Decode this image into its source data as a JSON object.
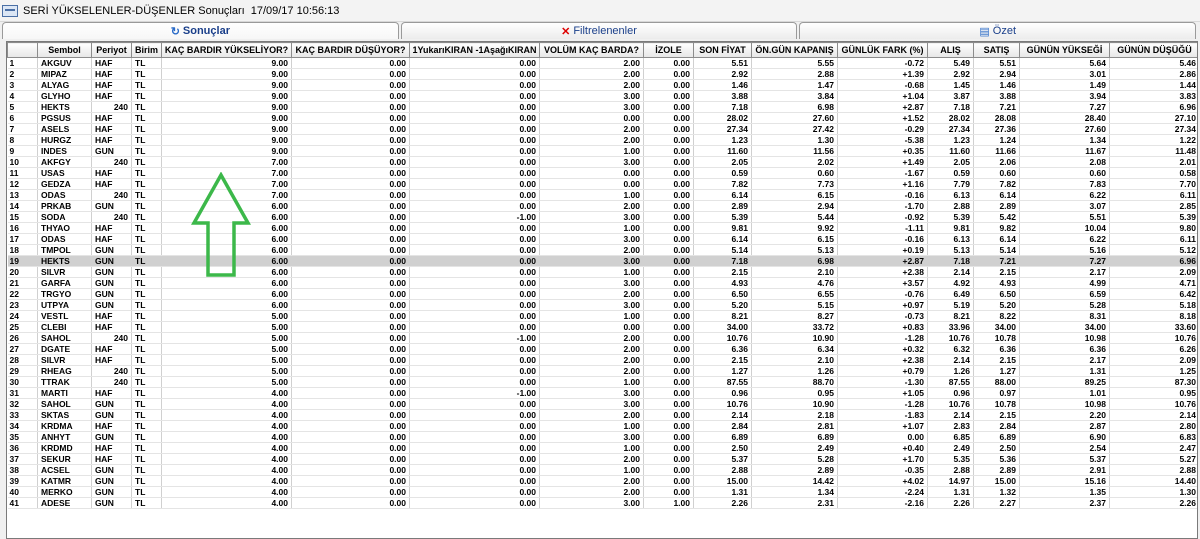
{
  "window": {
    "title": "SERİ YÜKSELENLER-DÜŞENLER Sonuçları",
    "timestamp": "17/09/17 10:56:13"
  },
  "tabs": [
    {
      "label": "Sonuçlar",
      "icon": "refresh-icon"
    },
    {
      "label": "Filtrelenenler",
      "icon": "red-x-icon"
    },
    {
      "label": "Özet",
      "icon": "summary-icon"
    }
  ],
  "table": {
    "headers": [
      "",
      "Sembol",
      "Periyot",
      "Birim",
      "KAÇ BARDIR YÜKSELİYOR?",
      "KAÇ BARDIR DÜŞÜYOR?",
      "1YukarıKIRAN -1AşağıKIRAN",
      "VOLÜM KAÇ BARDA?",
      "İZOLE",
      "SON FİYAT",
      "ÖN.GÜN KAPANIŞ",
      "GÜNLÜK FARK (%)",
      "ALIŞ",
      "SATIŞ",
      "GÜNÜN YÜKSEĞİ",
      "GÜNÜN DÜŞÜĞÜ"
    ],
    "selected_row": 19,
    "rows": [
      [
        "1",
        "AKGUV",
        "HAF",
        "TL",
        "9.00",
        "0.00",
        "0.00",
        "2.00",
        "0.00",
        "5.51",
        "5.55",
        "-0.72",
        "5.49",
        "5.51",
        "5.64",
        "5.46"
      ],
      [
        "2",
        "MIPAZ",
        "HAF",
        "TL",
        "9.00",
        "0.00",
        "0.00",
        "2.00",
        "0.00",
        "2.92",
        "2.88",
        "+1.39",
        "2.92",
        "2.94",
        "3.01",
        "2.86"
      ],
      [
        "3",
        "ALYAG",
        "HAF",
        "TL",
        "9.00",
        "0.00",
        "0.00",
        "2.00",
        "0.00",
        "1.46",
        "1.47",
        "-0.68",
        "1.45",
        "1.46",
        "1.49",
        "1.44"
      ],
      [
        "4",
        "GLYHO",
        "HAF",
        "TL",
        "9.00",
        "0.00",
        "0.00",
        "3.00",
        "0.00",
        "3.88",
        "3.84",
        "+1.04",
        "3.87",
        "3.88",
        "3.94",
        "3.83"
      ],
      [
        "5",
        "HEKTS",
        "240",
        "TL",
        "9.00",
        "0.00",
        "0.00",
        "3.00",
        "0.00",
        "7.18",
        "6.98",
        "+2.87",
        "7.18",
        "7.21",
        "7.27",
        "6.96"
      ],
      [
        "6",
        "PGSUS",
        "HAF",
        "TL",
        "9.00",
        "0.00",
        "0.00",
        "0.00",
        "0.00",
        "28.02",
        "27.60",
        "+1.52",
        "28.02",
        "28.08",
        "28.40",
        "27.10"
      ],
      [
        "7",
        "ASELS",
        "HAF",
        "TL",
        "9.00",
        "0.00",
        "0.00",
        "2.00",
        "0.00",
        "27.34",
        "27.42",
        "-0.29",
        "27.34",
        "27.36",
        "27.60",
        "27.34"
      ],
      [
        "8",
        "HURGZ",
        "HAF",
        "TL",
        "9.00",
        "0.00",
        "0.00",
        "2.00",
        "0.00",
        "1.23",
        "1.30",
        "-5.38",
        "1.23",
        "1.24",
        "1.34",
        "1.22"
      ],
      [
        "9",
        "INDES",
        "GUN",
        "TL",
        "9.00",
        "0.00",
        "0.00",
        "1.00",
        "0.00",
        "11.60",
        "11.56",
        "+0.35",
        "11.60",
        "11.66",
        "11.67",
        "11.48"
      ],
      [
        "10",
        "AKFGY",
        "240",
        "TL",
        "7.00",
        "0.00",
        "0.00",
        "3.00",
        "0.00",
        "2.05",
        "2.02",
        "+1.49",
        "2.05",
        "2.06",
        "2.08",
        "2.01"
      ],
      [
        "11",
        "USAS",
        "HAF",
        "TL",
        "7.00",
        "0.00",
        "0.00",
        "0.00",
        "0.00",
        "0.59",
        "0.60",
        "-1.67",
        "0.59",
        "0.60",
        "0.60",
        "0.58"
      ],
      [
        "12",
        "GEDZA",
        "HAF",
        "TL",
        "7.00",
        "0.00",
        "0.00",
        "0.00",
        "0.00",
        "7.82",
        "7.73",
        "+1.16",
        "7.79",
        "7.82",
        "7.83",
        "7.70"
      ],
      [
        "13",
        "ODAS",
        "240",
        "TL",
        "7.00",
        "0.00",
        "0.00",
        "1.00",
        "0.00",
        "6.14",
        "6.15",
        "-0.16",
        "6.13",
        "6.14",
        "6.22",
        "6.11"
      ],
      [
        "14",
        "PRKAB",
        "GUN",
        "TL",
        "6.00",
        "0.00",
        "0.00",
        "2.00",
        "0.00",
        "2.89",
        "2.94",
        "-1.70",
        "2.88",
        "2.89",
        "3.07",
        "2.85"
      ],
      [
        "15",
        "SODA",
        "240",
        "TL",
        "6.00",
        "0.00",
        "-1.00",
        "3.00",
        "0.00",
        "5.39",
        "5.44",
        "-0.92",
        "5.39",
        "5.42",
        "5.51",
        "5.39"
      ],
      [
        "16",
        "THYAO",
        "HAF",
        "TL",
        "6.00",
        "0.00",
        "0.00",
        "1.00",
        "0.00",
        "9.81",
        "9.92",
        "-1.11",
        "9.81",
        "9.82",
        "10.04",
        "9.80"
      ],
      [
        "17",
        "ODAS",
        "HAF",
        "TL",
        "6.00",
        "0.00",
        "0.00",
        "3.00",
        "0.00",
        "6.14",
        "6.15",
        "-0.16",
        "6.13",
        "6.14",
        "6.22",
        "6.11"
      ],
      [
        "18",
        "TMPOL",
        "GUN",
        "TL",
        "6.00",
        "0.00",
        "0.00",
        "2.00",
        "0.00",
        "5.14",
        "5.13",
        "+0.19",
        "5.13",
        "5.14",
        "5.16",
        "5.12"
      ],
      [
        "19",
        "HEKTS",
        "GUN",
        "TL",
        "6.00",
        "0.00",
        "0.00",
        "3.00",
        "0.00",
        "7.18",
        "6.98",
        "+2.87",
        "7.18",
        "7.21",
        "7.27",
        "6.96"
      ],
      [
        "20",
        "SILVR",
        "GUN",
        "TL",
        "6.00",
        "0.00",
        "0.00",
        "1.00",
        "0.00",
        "2.15",
        "2.10",
        "+2.38",
        "2.14",
        "2.15",
        "2.17",
        "2.09"
      ],
      [
        "21",
        "GARFA",
        "GUN",
        "TL",
        "6.00",
        "0.00",
        "0.00",
        "3.00",
        "0.00",
        "4.93",
        "4.76",
        "+3.57",
        "4.92",
        "4.93",
        "4.99",
        "4.71"
      ],
      [
        "22",
        "TRGYO",
        "GUN",
        "TL",
        "6.00",
        "0.00",
        "0.00",
        "2.00",
        "0.00",
        "6.50",
        "6.55",
        "-0.76",
        "6.49",
        "6.50",
        "6.59",
        "6.42"
      ],
      [
        "23",
        "UTPYA",
        "GUN",
        "TL",
        "6.00",
        "0.00",
        "0.00",
        "3.00",
        "0.00",
        "5.20",
        "5.15",
        "+0.97",
        "5.19",
        "5.20",
        "5.28",
        "5.18"
      ],
      [
        "24",
        "VESTL",
        "HAF",
        "TL",
        "5.00",
        "0.00",
        "0.00",
        "1.00",
        "0.00",
        "8.21",
        "8.27",
        "-0.73",
        "8.21",
        "8.22",
        "8.31",
        "8.18"
      ],
      [
        "25",
        "CLEBI",
        "HAF",
        "TL",
        "5.00",
        "0.00",
        "0.00",
        "0.00",
        "0.00",
        "34.00",
        "33.72",
        "+0.83",
        "33.96",
        "34.00",
        "34.00",
        "33.60"
      ],
      [
        "26",
        "SAHOL",
        "240",
        "TL",
        "5.00",
        "0.00",
        "-1.00",
        "2.00",
        "0.00",
        "10.76",
        "10.90",
        "-1.28",
        "10.76",
        "10.78",
        "10.98",
        "10.76"
      ],
      [
        "27",
        "DGATE",
        "HAF",
        "TL",
        "5.00",
        "0.00",
        "0.00",
        "2.00",
        "0.00",
        "6.36",
        "6.34",
        "+0.32",
        "6.32",
        "6.36",
        "6.36",
        "6.26"
      ],
      [
        "28",
        "SILVR",
        "HAF",
        "TL",
        "5.00",
        "0.00",
        "0.00",
        "2.00",
        "0.00",
        "2.15",
        "2.10",
        "+2.38",
        "2.14",
        "2.15",
        "2.17",
        "2.09"
      ],
      [
        "29",
        "RHEAG",
        "240",
        "TL",
        "5.00",
        "0.00",
        "0.00",
        "2.00",
        "0.00",
        "1.27",
        "1.26",
        "+0.79",
        "1.26",
        "1.27",
        "1.31",
        "1.25"
      ],
      [
        "30",
        "TTRAK",
        "240",
        "TL",
        "5.00",
        "0.00",
        "0.00",
        "1.00",
        "0.00",
        "87.55",
        "88.70",
        "-1.30",
        "87.55",
        "88.00",
        "89.25",
        "87.30"
      ],
      [
        "31",
        "MARTI",
        "HAF",
        "TL",
        "4.00",
        "0.00",
        "-1.00",
        "3.00",
        "0.00",
        "0.96",
        "0.95",
        "+1.05",
        "0.96",
        "0.97",
        "1.01",
        "0.95"
      ],
      [
        "32",
        "SAHOL",
        "GUN",
        "TL",
        "4.00",
        "0.00",
        "0.00",
        "3.00",
        "0.00",
        "10.76",
        "10.90",
        "-1.28",
        "10.76",
        "10.78",
        "10.98",
        "10.76"
      ],
      [
        "33",
        "SKTAS",
        "GUN",
        "TL",
        "4.00",
        "0.00",
        "0.00",
        "2.00",
        "0.00",
        "2.14",
        "2.18",
        "-1.83",
        "2.14",
        "2.15",
        "2.20",
        "2.14"
      ],
      [
        "34",
        "KRDMA",
        "HAF",
        "TL",
        "4.00",
        "0.00",
        "0.00",
        "1.00",
        "0.00",
        "2.84",
        "2.81",
        "+1.07",
        "2.83",
        "2.84",
        "2.87",
        "2.80"
      ],
      [
        "35",
        "ANHYT",
        "GUN",
        "TL",
        "4.00",
        "0.00",
        "0.00",
        "3.00",
        "0.00",
        "6.89",
        "6.89",
        "0.00",
        "6.85",
        "6.89",
        "6.90",
        "6.83"
      ],
      [
        "36",
        "KRDMD",
        "HAF",
        "TL",
        "4.00",
        "0.00",
        "0.00",
        "1.00",
        "0.00",
        "2.50",
        "2.49",
        "+0.40",
        "2.49",
        "2.50",
        "2.54",
        "2.47"
      ],
      [
        "37",
        "SEKUR",
        "HAF",
        "TL",
        "4.00",
        "0.00",
        "0.00",
        "2.00",
        "0.00",
        "5.37",
        "5.28",
        "+1.70",
        "5.35",
        "5.36",
        "5.37",
        "5.27"
      ],
      [
        "38",
        "ACSEL",
        "GUN",
        "TL",
        "4.00",
        "0.00",
        "0.00",
        "1.00",
        "0.00",
        "2.88",
        "2.89",
        "-0.35",
        "2.88",
        "2.89",
        "2.91",
        "2.88"
      ],
      [
        "39",
        "KATMR",
        "GUN",
        "TL",
        "4.00",
        "0.00",
        "0.00",
        "2.00",
        "0.00",
        "15.00",
        "14.42",
        "+4.02",
        "14.97",
        "15.00",
        "15.16",
        "14.40"
      ],
      [
        "40",
        "MERKO",
        "GUN",
        "TL",
        "4.00",
        "0.00",
        "0.00",
        "2.00",
        "0.00",
        "1.31",
        "1.34",
        "-2.24",
        "1.31",
        "1.32",
        "1.35",
        "1.30"
      ],
      [
        "41",
        "ADESE",
        "GUN",
        "TL",
        "4.00",
        "0.00",
        "0.00",
        "3.00",
        "1.00",
        "2.26",
        "2.31",
        "-2.16",
        "2.26",
        "2.27",
        "2.37",
        "2.26"
      ]
    ]
  },
  "colors": {
    "arrow": "#3cb84a",
    "selected_row_bg": "#d0d0d0",
    "tab_text": "#1a3f8a"
  }
}
